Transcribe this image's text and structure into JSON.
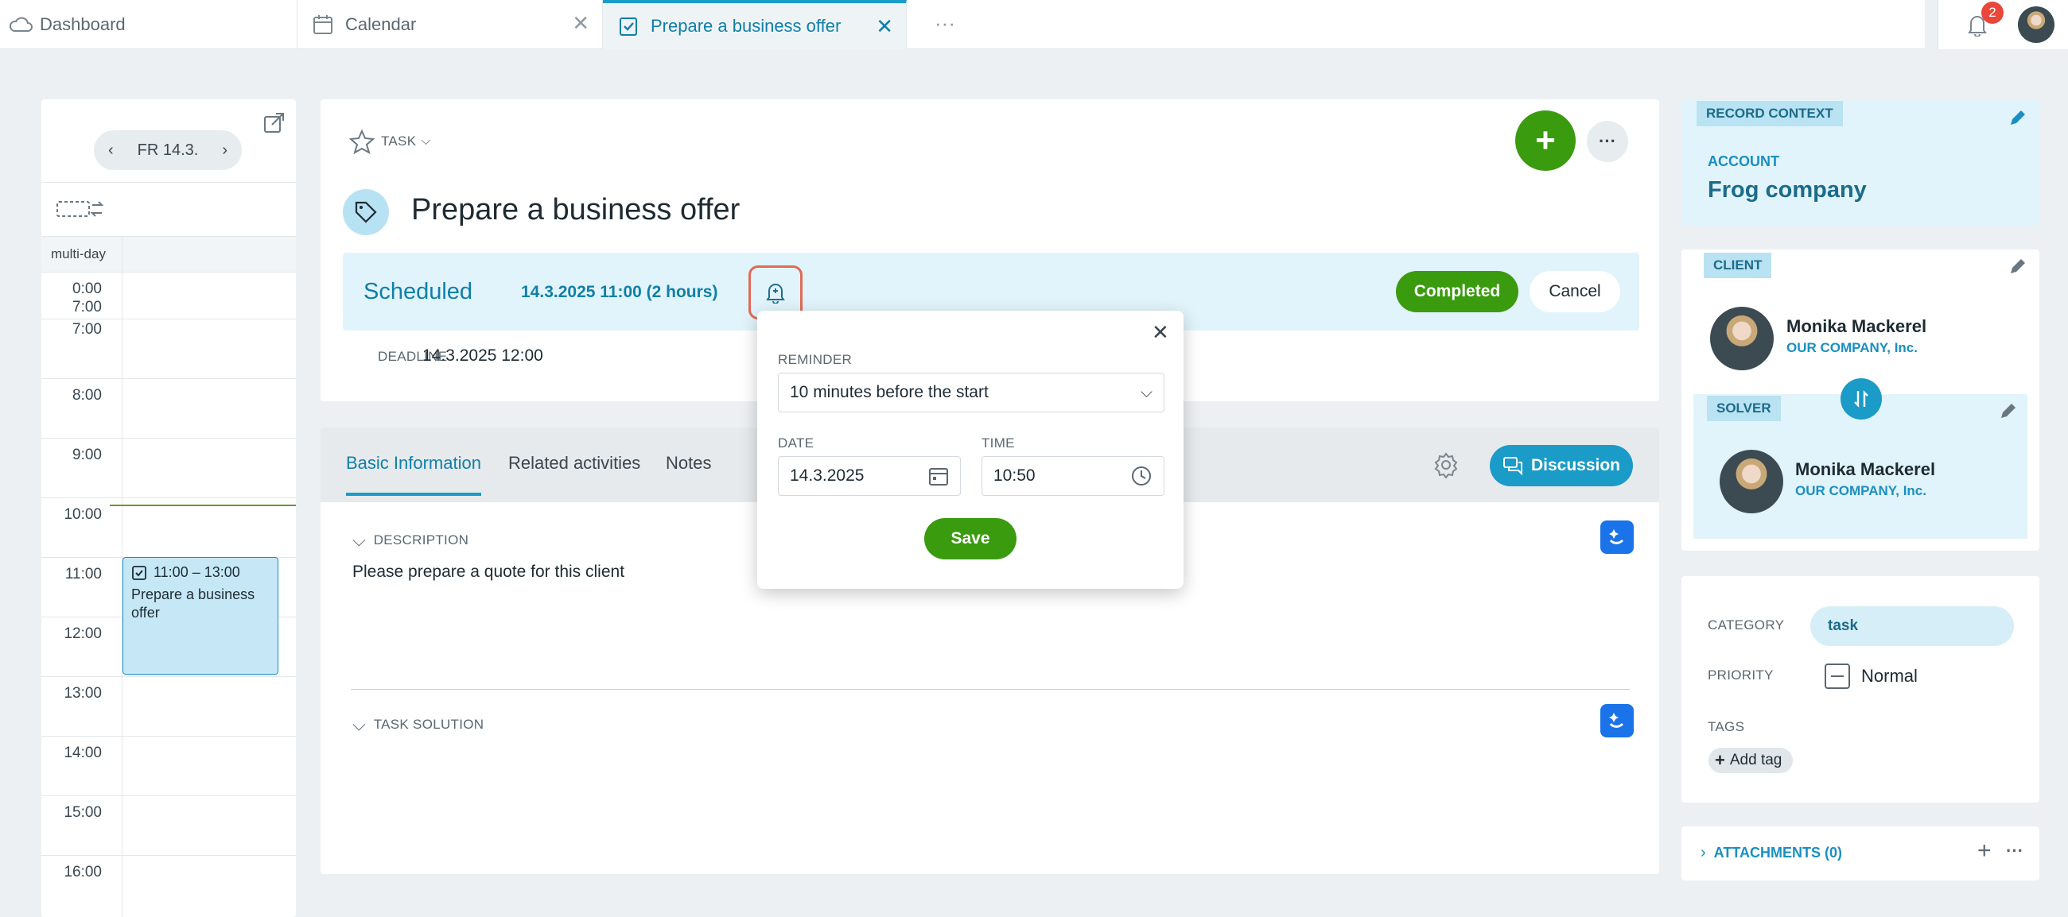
{
  "tabs": [
    {
      "label": "Dashboard",
      "icon": "cloud-icon"
    },
    {
      "label": "Calendar",
      "icon": "calendar-icon"
    },
    {
      "label": "Prepare a business offer",
      "icon": "task-check-icon"
    }
  ],
  "header": {
    "notifications_count": "2"
  },
  "calendar": {
    "date_label": "FR 14.3.",
    "multiday_label": "multi-day",
    "hours": [
      "0:00",
      "7:00",
      "7:00",
      "8:00",
      "9:00",
      "10:00",
      "11:00",
      "12:00",
      "13:00",
      "14:00",
      "15:00",
      "16:00"
    ],
    "event": {
      "time": "11:00 – 13:00",
      "title": "Prepare a business offer"
    }
  },
  "task": {
    "type_label": "TASK",
    "title": "Prepare a business offer",
    "status": "Scheduled",
    "schedule": "14.3.2025 11:00 (2 hours)",
    "deadline_label": "DEADLINE",
    "deadline": "14.3.2025 12:00",
    "completed_label": "Completed",
    "cancel_label": "Cancel"
  },
  "detail_tabs": {
    "items": [
      "Basic Information",
      "Related activities",
      "Notes"
    ],
    "discussion_label": "Discussion"
  },
  "description": {
    "label": "DESCRIPTION",
    "text": "Please prepare a quote for this client",
    "solution_label": "TASK SOLUTION"
  },
  "reminder_popup": {
    "reminder_label": "REMINDER",
    "reminder_value": "10 minutes before the start",
    "date_label": "DATE",
    "date_value": "14.3.2025",
    "time_label": "TIME",
    "time_value": "10:50",
    "save_label": "Save"
  },
  "record_context": {
    "label": "RECORD CONTEXT",
    "account_label": "ACCOUNT",
    "account_name": "Frog company"
  },
  "client": {
    "label": "CLIENT",
    "name": "Monika Mackerel",
    "company": "OUR COMPANY, Inc."
  },
  "solver": {
    "label": "SOLVER",
    "name": "Monika Mackerel",
    "company": "OUR COMPANY, Inc."
  },
  "meta": {
    "category_label": "CATEGORY",
    "category_value": "task",
    "priority_label": "PRIORITY",
    "priority_value": "Normal",
    "tags_label": "TAGS",
    "add_tag_label": "Add tag"
  },
  "attachments": {
    "label": "ATTACHMENTS (0)"
  },
  "colors": {
    "accent": "#1a9bc8",
    "green": "#3a9b0f",
    "highlight": "#e2f4fb"
  }
}
